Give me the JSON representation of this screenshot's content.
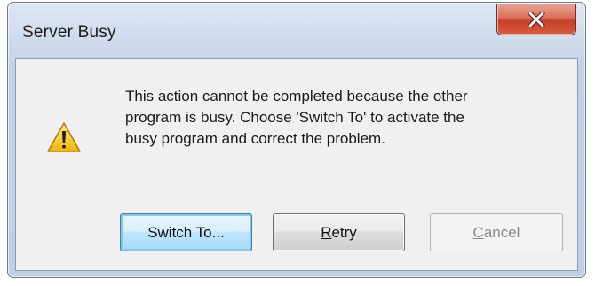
{
  "window": {
    "title": "Server Busy"
  },
  "icons": {
    "close": "close-icon",
    "warning": "warning-icon"
  },
  "dialog": {
    "message_lines": [
      "This action cannot be completed because the other",
      "program is busy. Choose 'Switch To' to activate the",
      "busy program and correct the problem."
    ]
  },
  "buttons": {
    "switch_to": {
      "label": "Switch To...",
      "state": "default"
    },
    "retry": {
      "mnemonic": "R",
      "label_rest": "etry",
      "state": "enabled"
    },
    "cancel": {
      "mnemonic": "C",
      "label_rest": "ancel",
      "state": "disabled"
    }
  },
  "colors": {
    "close_button": "#c6402a",
    "default_button_border": "#3c7fb1",
    "warning_yellow": "#f5c400"
  }
}
